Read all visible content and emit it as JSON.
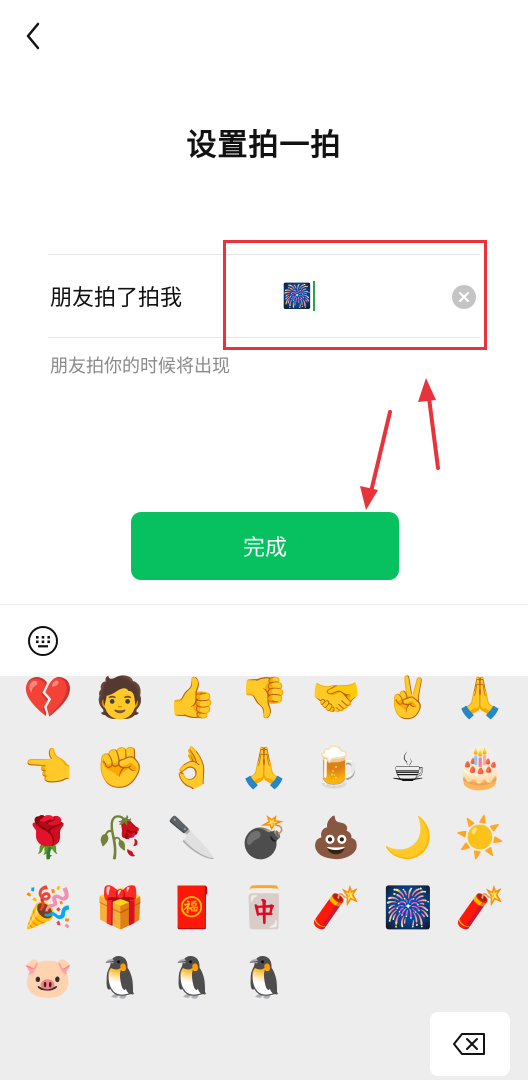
{
  "page": {
    "title": "设置拍一拍",
    "pat_label": "朋友拍了拍我",
    "input_value": "🎆",
    "hint": "朋友拍你的时候将出现",
    "done_label": "完成"
  },
  "colors": {
    "accent": "#07c160",
    "annotation_red": "#e8333a",
    "panel_bg": "#ededed"
  },
  "icons": {
    "back": "chevron-left-icon",
    "clear": "clear-circle-icon",
    "keyboard": "keyboard-icon",
    "delete": "backspace-icon"
  },
  "emojis": [
    "💔",
    "🧑",
    "👍",
    "👎",
    "🤝",
    "✌️",
    "🙏",
    "👈",
    "✊",
    "👌",
    "🙏",
    "🍺",
    "☕",
    "🎂",
    "🌹",
    "🥀",
    "🔪",
    "💣",
    "💩",
    "🌙",
    "☀️",
    "🎉",
    "🎁",
    "🧧",
    "🀄",
    "🧨",
    "🎆",
    "🧨",
    "🐷",
    "🐧",
    "🐧",
    "🐧"
  ]
}
